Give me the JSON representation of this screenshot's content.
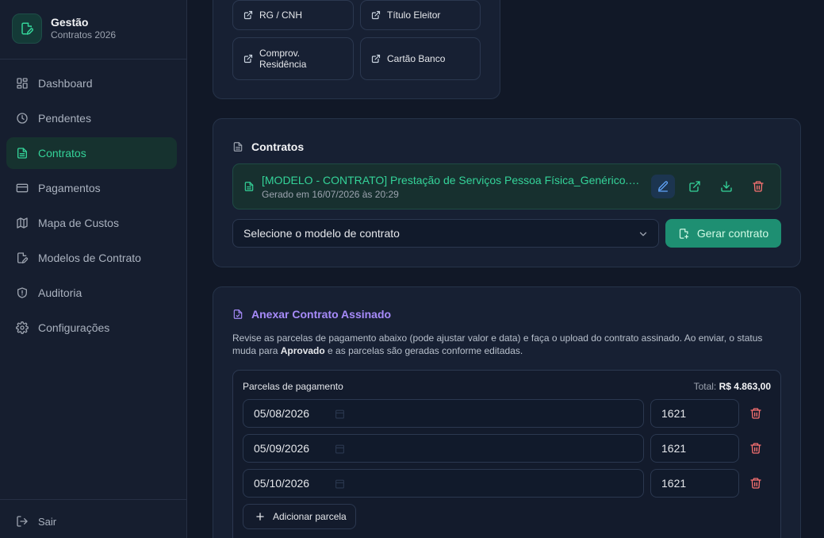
{
  "brand": {
    "title": "Gestão",
    "subtitle": "Contratos 2026"
  },
  "sidebar": {
    "items": [
      {
        "label": "Dashboard",
        "icon": "layout-grid-icon",
        "active": false
      },
      {
        "label": "Pendentes",
        "icon": "clock-icon",
        "active": false
      },
      {
        "label": "Contratos",
        "icon": "file-text-icon",
        "active": true
      },
      {
        "label": "Pagamentos",
        "icon": "credit-card-icon",
        "active": false
      },
      {
        "label": "Mapa de Custos",
        "icon": "map-icon",
        "active": false
      },
      {
        "label": "Modelos de Contrato",
        "icon": "file-edit-icon",
        "active": false
      },
      {
        "label": "Auditoria",
        "icon": "shield-icon",
        "active": false
      },
      {
        "label": "Configurações",
        "icon": "gear-icon",
        "active": false
      }
    ],
    "logout": "Sair"
  },
  "documents": {
    "buttons": [
      "RG / CNH",
      "Título Eleitor",
      "Comprov.\nResidência",
      "Cartão Banco"
    ]
  },
  "contracts": {
    "title": "Contratos",
    "item": {
      "name": "[MODELO - CONTRATO] Prestação de Serviços Pessoa Física_Genérico.docx",
      "meta": "Gerado em 16/07/2026 às 20:29"
    },
    "select_placeholder": "Selecione o modelo de contrato",
    "generate_label": "Gerar contrato"
  },
  "attach": {
    "title": "Anexar Contrato Assinado",
    "desc_part1": "Revise as parcelas de pagamento abaixo (pode ajustar valor e data) e faça o upload do contrato assinado. Ao enviar, o status muda para ",
    "desc_bold": "Aprovado",
    "desc_part2": " e as parcelas são geradas conforme editadas.",
    "installments_label": "Parcelas de pagamento",
    "total_label": "Total:",
    "total_value": "R$ 4.863,00",
    "installments": [
      {
        "date": "05/08/2026",
        "value": "1621"
      },
      {
        "date": "05/09/2026",
        "value": "1621"
      },
      {
        "date": "05/10/2026",
        "value": "1621"
      }
    ],
    "add_label": "Adicionar parcela"
  },
  "colors": {
    "accent": "#34d399",
    "purple": "#a78bfa",
    "danger": "#f87171",
    "generate_bg": "#1e8f72"
  }
}
